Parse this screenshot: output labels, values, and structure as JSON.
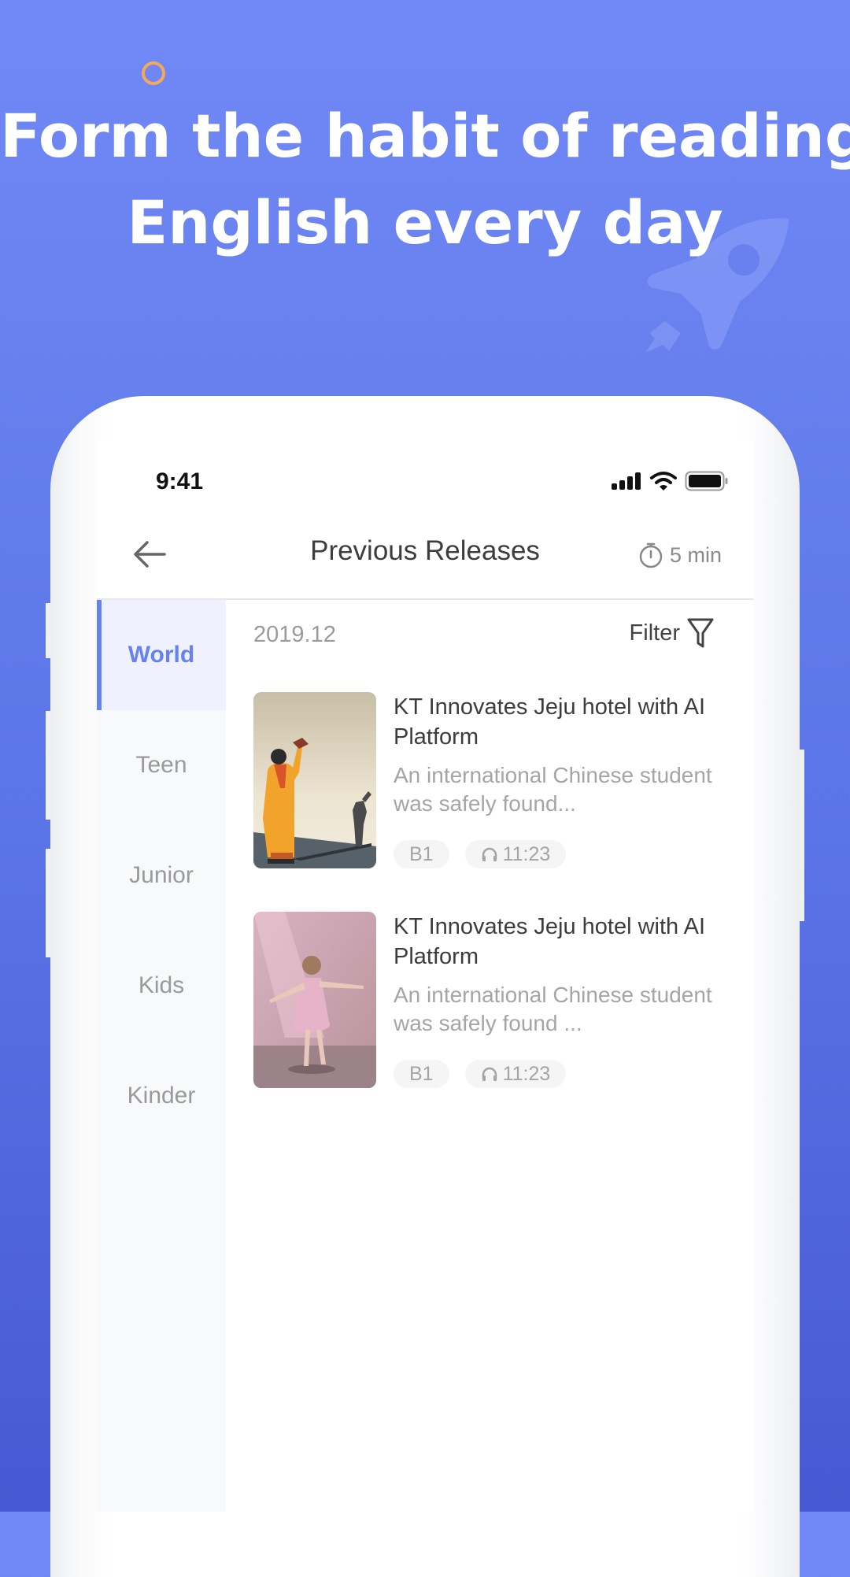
{
  "promo": {
    "headline_line1": "Form the habit of reading",
    "headline_line2": "English every day",
    "accent_color": "#f4a85a",
    "background_color": "#6780ee"
  },
  "status_bar": {
    "time": "9:41",
    "icons": [
      "cellular-signal-icon",
      "wifi-icon",
      "battery-icon"
    ]
  },
  "nav": {
    "back_icon": "arrow-left-icon",
    "title": "Previous Releases",
    "timer_icon": "stopwatch-icon",
    "timer_label": "5 min"
  },
  "sidebar": {
    "active_color": "#6681f0",
    "items": [
      {
        "label": "World",
        "active": true
      },
      {
        "label": "Teen",
        "active": false
      },
      {
        "label": "Junior",
        "active": false
      },
      {
        "label": "Kids",
        "active": false
      },
      {
        "label": "Kinder",
        "active": false
      }
    ]
  },
  "content": {
    "date": "2019.12",
    "filter_label": "Filter",
    "filter_icon": "funnel-icon",
    "articles": [
      {
        "title": "KT Innovates Jeju hotel with AI Platform",
        "description": "An international Chinese student was safely found...",
        "level": "B1",
        "duration_icon": "headphones-icon",
        "duration": "11:23",
        "thumbnail": "man-in-orange-coat-tipping-hat-illustration"
      },
      {
        "title": "KT Innovates Jeju hotel with AI Platform",
        "description": "An international Chinese student was safely found ...",
        "level": "B1",
        "duration_icon": "headphones-icon",
        "duration": "11:23",
        "thumbnail": "girl-in-pink-dress-dancing-photo"
      }
    ]
  }
}
